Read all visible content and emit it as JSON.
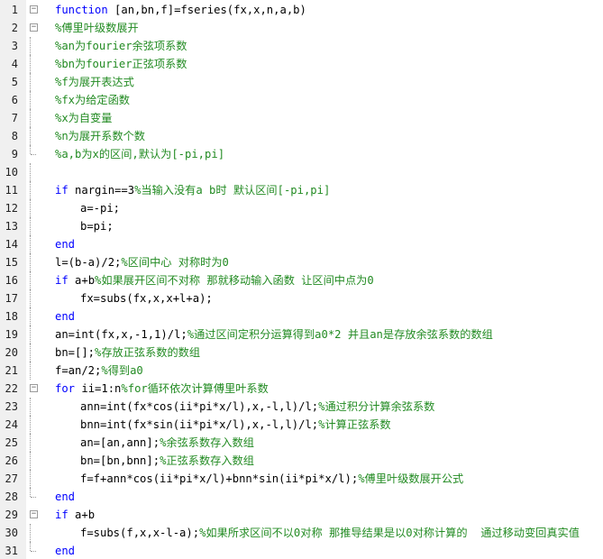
{
  "lines": [
    {
      "n": "1",
      "indent": 0,
      "parts": [
        {
          "t": "function",
          "c": "kw"
        },
        {
          "t": " [an,bn,f]=fseries(fx,x,n,a,b)",
          "c": "nb"
        }
      ],
      "fold": "minus"
    },
    {
      "n": "2",
      "indent": 0,
      "parts": [
        {
          "t": "%傅里叶级数展开",
          "c": "cm"
        }
      ],
      "fold": "minus"
    },
    {
      "n": "3",
      "indent": 0,
      "parts": [
        {
          "t": "%an为fourier余弦项系数",
          "c": "cm"
        }
      ],
      "fold": "bar"
    },
    {
      "n": "4",
      "indent": 0,
      "parts": [
        {
          "t": "%bn为fourier正弦项系数",
          "c": "cm"
        }
      ],
      "fold": "bar"
    },
    {
      "n": "5",
      "indent": 0,
      "parts": [
        {
          "t": "%f为展开表达式",
          "c": "cm"
        }
      ],
      "fold": "bar"
    },
    {
      "n": "6",
      "indent": 0,
      "parts": [
        {
          "t": "%fx为给定函数",
          "c": "cm"
        }
      ],
      "fold": "bar"
    },
    {
      "n": "7",
      "indent": 0,
      "parts": [
        {
          "t": "%x为自变量",
          "c": "cm"
        }
      ],
      "fold": "bar"
    },
    {
      "n": "8",
      "indent": 0,
      "parts": [
        {
          "t": "%n为展开系数个数",
          "c": "cm"
        }
      ],
      "fold": "bar"
    },
    {
      "n": "9",
      "indent": 0,
      "parts": [
        {
          "t": "%a,b为x的区间,默认为[-pi,pi]",
          "c": "cm"
        }
      ],
      "fold": "end"
    },
    {
      "n": "10",
      "indent": 0,
      "parts": [],
      "fold": "bar"
    },
    {
      "n": "11",
      "indent": 0,
      "parts": [
        {
          "t": "if",
          "c": "kw"
        },
        {
          "t": " nargin==3",
          "c": "nb"
        },
        {
          "t": "%当输入没有a b时 默认区间[-pi,pi]",
          "c": "cm"
        }
      ],
      "fold": "bar"
    },
    {
      "n": "12",
      "indent": 1,
      "parts": [
        {
          "t": "a=-pi;",
          "c": "nb"
        }
      ],
      "fold": "bar"
    },
    {
      "n": "13",
      "indent": 1,
      "parts": [
        {
          "t": "b=pi;",
          "c": "nb"
        }
      ],
      "fold": "bar"
    },
    {
      "n": "14",
      "indent": 0,
      "parts": [
        {
          "t": "end",
          "c": "kw"
        }
      ],
      "fold": "bar"
    },
    {
      "n": "15",
      "indent": 0,
      "parts": [
        {
          "t": "l=(b-a)/2;",
          "c": "nb"
        },
        {
          "t": "%区间中心 对称时为0",
          "c": "cm"
        }
      ],
      "fold": "bar"
    },
    {
      "n": "16",
      "indent": 0,
      "parts": [
        {
          "t": "if",
          "c": "kw"
        },
        {
          "t": " a+b",
          "c": "nb"
        },
        {
          "t": "%如果展开区间不对称 那就移动输入函数 让区间中点为0",
          "c": "cm"
        }
      ],
      "fold": "bar"
    },
    {
      "n": "17",
      "indent": 1,
      "parts": [
        {
          "t": "fx=subs(fx,x,x+l+a);",
          "c": "nb"
        }
      ],
      "fold": "bar"
    },
    {
      "n": "18",
      "indent": 0,
      "parts": [
        {
          "t": "end",
          "c": "kw"
        }
      ],
      "fold": "bar"
    },
    {
      "n": "19",
      "indent": 0,
      "parts": [
        {
          "t": "an=int(fx,x,-1,1)/l;",
          "c": "nb"
        },
        {
          "t": "%通过区间定积分运算得到a0*2 并且an是存放余弦系数的数组",
          "c": "cm"
        }
      ],
      "fold": "bar"
    },
    {
      "n": "20",
      "indent": 0,
      "parts": [
        {
          "t": "bn=[];",
          "c": "nb"
        },
        {
          "t": "%存放正弦系数的数组",
          "c": "cm"
        }
      ],
      "fold": "bar"
    },
    {
      "n": "21",
      "indent": 0,
      "parts": [
        {
          "t": "f=an/2;",
          "c": "nb"
        },
        {
          "t": "%得到a0",
          "c": "cm"
        }
      ],
      "fold": "bar"
    },
    {
      "n": "22",
      "indent": 0,
      "parts": [
        {
          "t": "for",
          "c": "kw"
        },
        {
          "t": " ii=1:n",
          "c": "nb"
        },
        {
          "t": "%for循环依次计算傅里叶系数",
          "c": "cm"
        }
      ],
      "fold": "minus"
    },
    {
      "n": "23",
      "indent": 1,
      "parts": [
        {
          "t": "ann=int(fx*cos(ii*pi*x/l),x,-l,l)/l;",
          "c": "nb"
        },
        {
          "t": "%通过积分计算余弦系数",
          "c": "cm"
        }
      ],
      "fold": "bar"
    },
    {
      "n": "24",
      "indent": 1,
      "parts": [
        {
          "t": "bnn=int(fx*sin(ii*pi*x/l),x,-l,l)/l;",
          "c": "nb"
        },
        {
          "t": "%计算正弦系数",
          "c": "cm"
        }
      ],
      "fold": "bar"
    },
    {
      "n": "25",
      "indent": 1,
      "parts": [
        {
          "t": "an=[an,ann];",
          "c": "nb"
        },
        {
          "t": "%余弦系数存入数组",
          "c": "cm"
        }
      ],
      "fold": "bar"
    },
    {
      "n": "26",
      "indent": 1,
      "parts": [
        {
          "t": "bn=[bn,bnn];",
          "c": "nb"
        },
        {
          "t": "%正弦系数存入数组",
          "c": "cm"
        }
      ],
      "fold": "bar"
    },
    {
      "n": "27",
      "indent": 1,
      "parts": [
        {
          "t": "f=f+ann*cos(ii*pi*x/l)+bnn*sin(ii*pi*x/l);",
          "c": "nb"
        },
        {
          "t": "%傅里叶级数展开公式",
          "c": "cm"
        }
      ],
      "fold": "bar"
    },
    {
      "n": "28",
      "indent": 0,
      "parts": [
        {
          "t": "end",
          "c": "kw"
        }
      ],
      "fold": "end"
    },
    {
      "n": "29",
      "indent": 0,
      "parts": [
        {
          "t": "if",
          "c": "kw"
        },
        {
          "t": " a+b",
          "c": "nb"
        }
      ],
      "fold": "minus"
    },
    {
      "n": "30",
      "indent": 1,
      "parts": [
        {
          "t": "f=subs(f,x,x-l-a);",
          "c": "nb"
        },
        {
          "t": "%如果所求区间不以0对称 那推导结果是以0对称计算的  通过移动变回真实值",
          "c": "cm"
        }
      ],
      "fold": "bar"
    },
    {
      "n": "31",
      "indent": 0,
      "parts": [
        {
          "t": "end",
          "c": "kw"
        }
      ],
      "fold": "end"
    }
  ],
  "colors": {
    "keyword": "#0000ff",
    "comment": "#228b22",
    "text": "#000000"
  }
}
